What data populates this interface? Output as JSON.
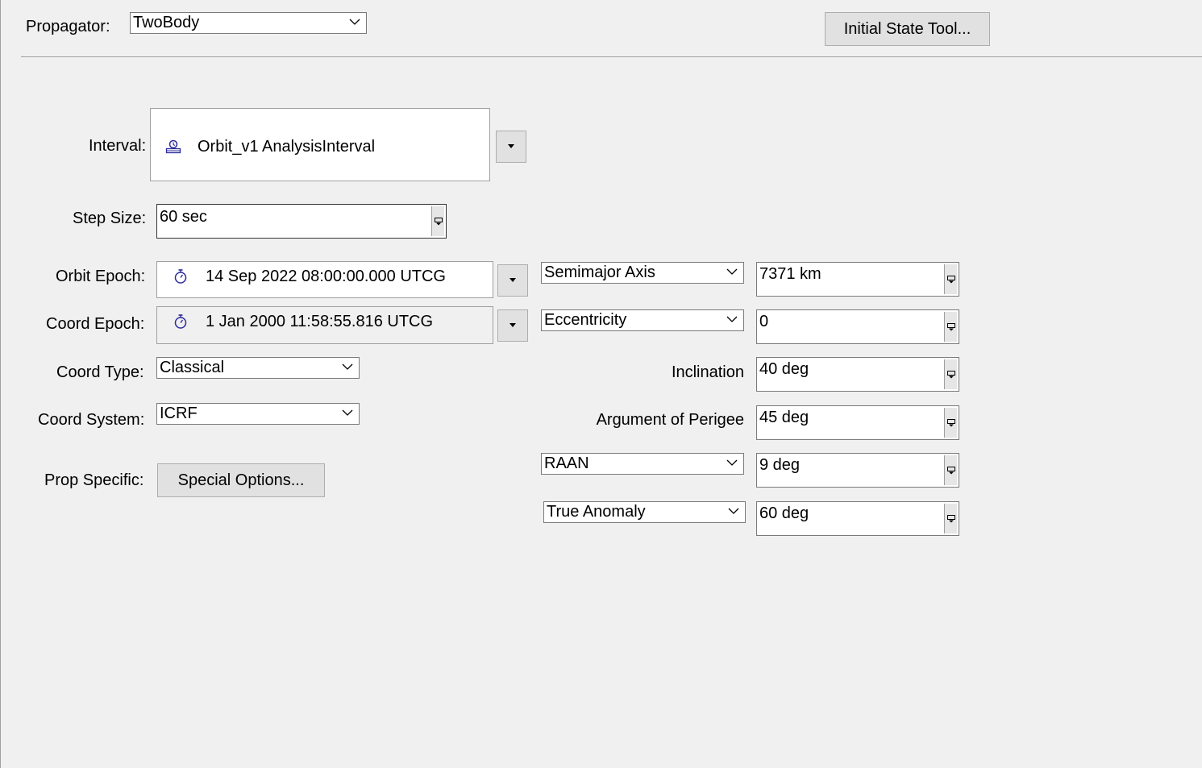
{
  "propagator": {
    "label": "Propagator:",
    "value": "TwoBody"
  },
  "initial_state_tool_label": "Initial State Tool...",
  "interval": {
    "label": "Interval:",
    "value": "Orbit_v1 AnalysisInterval"
  },
  "step_size": {
    "label": "Step Size:",
    "value": "60 sec"
  },
  "orbit_epoch": {
    "label": "Orbit Epoch:",
    "value": "14 Sep 2022 08:00:00.000 UTCG"
  },
  "coord_epoch": {
    "label": "Coord Epoch:",
    "value": "1 Jan 2000 11:58:55.816 UTCG"
  },
  "coord_type": {
    "label": "Coord Type:",
    "value": "Classical"
  },
  "coord_system": {
    "label": "Coord System:",
    "value": "ICRF"
  },
  "prop_specific": {
    "label": "Prop Specific:",
    "button": "Special Options..."
  },
  "elements": {
    "semimajor_axis": {
      "selector": "Semimajor Axis",
      "value": "7371 km"
    },
    "eccentricity": {
      "selector": "Eccentricity",
      "value": "0"
    },
    "inclination": {
      "label": "Inclination",
      "value": "40 deg"
    },
    "argument_of_perigee": {
      "label": "Argument of Perigee",
      "value": "45 deg"
    },
    "raan": {
      "selector": "RAAN",
      "value": "9 deg"
    },
    "true_anomaly": {
      "selector": "True Anomaly",
      "value": "60 deg"
    }
  },
  "icons": {
    "interval": "interval-link-icon",
    "epoch": "stopwatch-icon",
    "unit": "unit-picker-icon",
    "chevron": "chevron-down-icon",
    "dropdown": "dropdown-arrow-icon"
  }
}
